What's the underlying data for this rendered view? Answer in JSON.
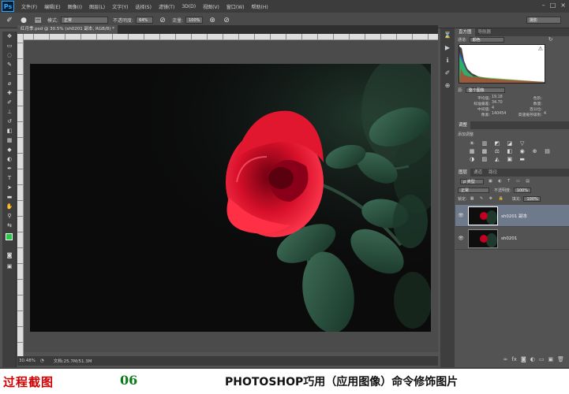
{
  "menubar": {
    "logo": "Ps",
    "items": [
      "文件(F)",
      "编辑(E)",
      "图像(I)",
      "图层(L)",
      "文字(Y)",
      "选择(S)",
      "滤镜(T)",
      "3D(D)",
      "视图(V)",
      "窗口(W)",
      "帮助(H)"
    ],
    "window_controls": [
      "–",
      "□",
      "×"
    ]
  },
  "options": {
    "mode_label": "模式:",
    "mode_value": "正常",
    "opacity_label": "不透明度:",
    "opacity_value": "64%",
    "flow_label": "流量:",
    "flow_value": "100%",
    "workspace": "摄影"
  },
  "document": {
    "tab_title": "红月季.psd @ 30.5% (sh0201 副本, RGB/8) *",
    "zoom": "30.48%",
    "doc_info": "文档:25.7M/51.3M"
  },
  "histogram": {
    "tabs": [
      "直方图",
      "导航器"
    ],
    "channel_label": "通道:",
    "channel_value": "颜色",
    "source_label": "源:",
    "source_value": "整个图像",
    "stats": [
      {
        "label": "平均值:",
        "value": "19.18",
        "label2": "色阶:",
        "value2": ""
      },
      {
        "label": "标准偏差:",
        "value": "34.70",
        "label2": "数量:",
        "value2": ""
      },
      {
        "label": "中间值:",
        "value": "4",
        "label2": "百分位:",
        "value2": ""
      },
      {
        "label": "像素:",
        "value": "140454",
        "label2": "高速缓存级别:",
        "value2": "4"
      }
    ]
  },
  "adjustments": {
    "tab": "调整",
    "title": "添加调整"
  },
  "layers": {
    "tabs": [
      "图层",
      "通道",
      "路径"
    ],
    "kind_label": "ρ 类型",
    "blend_mode": "正常",
    "opacity_label": "不透明度:",
    "opacity_value": "100%",
    "lock_label": "锁定:",
    "fill_label": "填充:",
    "fill_value": "100%",
    "items": [
      {
        "name": "sh0201 副本",
        "selected": true
      },
      {
        "name": "sh0201",
        "selected": false
      }
    ]
  },
  "caption": {
    "left": "过程截图",
    "number": "06",
    "title": "PHOTOSHOP巧用（应用图像）命令修饰图片"
  },
  "colors": {
    "foreground": "#22cc44",
    "background": "#000000"
  }
}
